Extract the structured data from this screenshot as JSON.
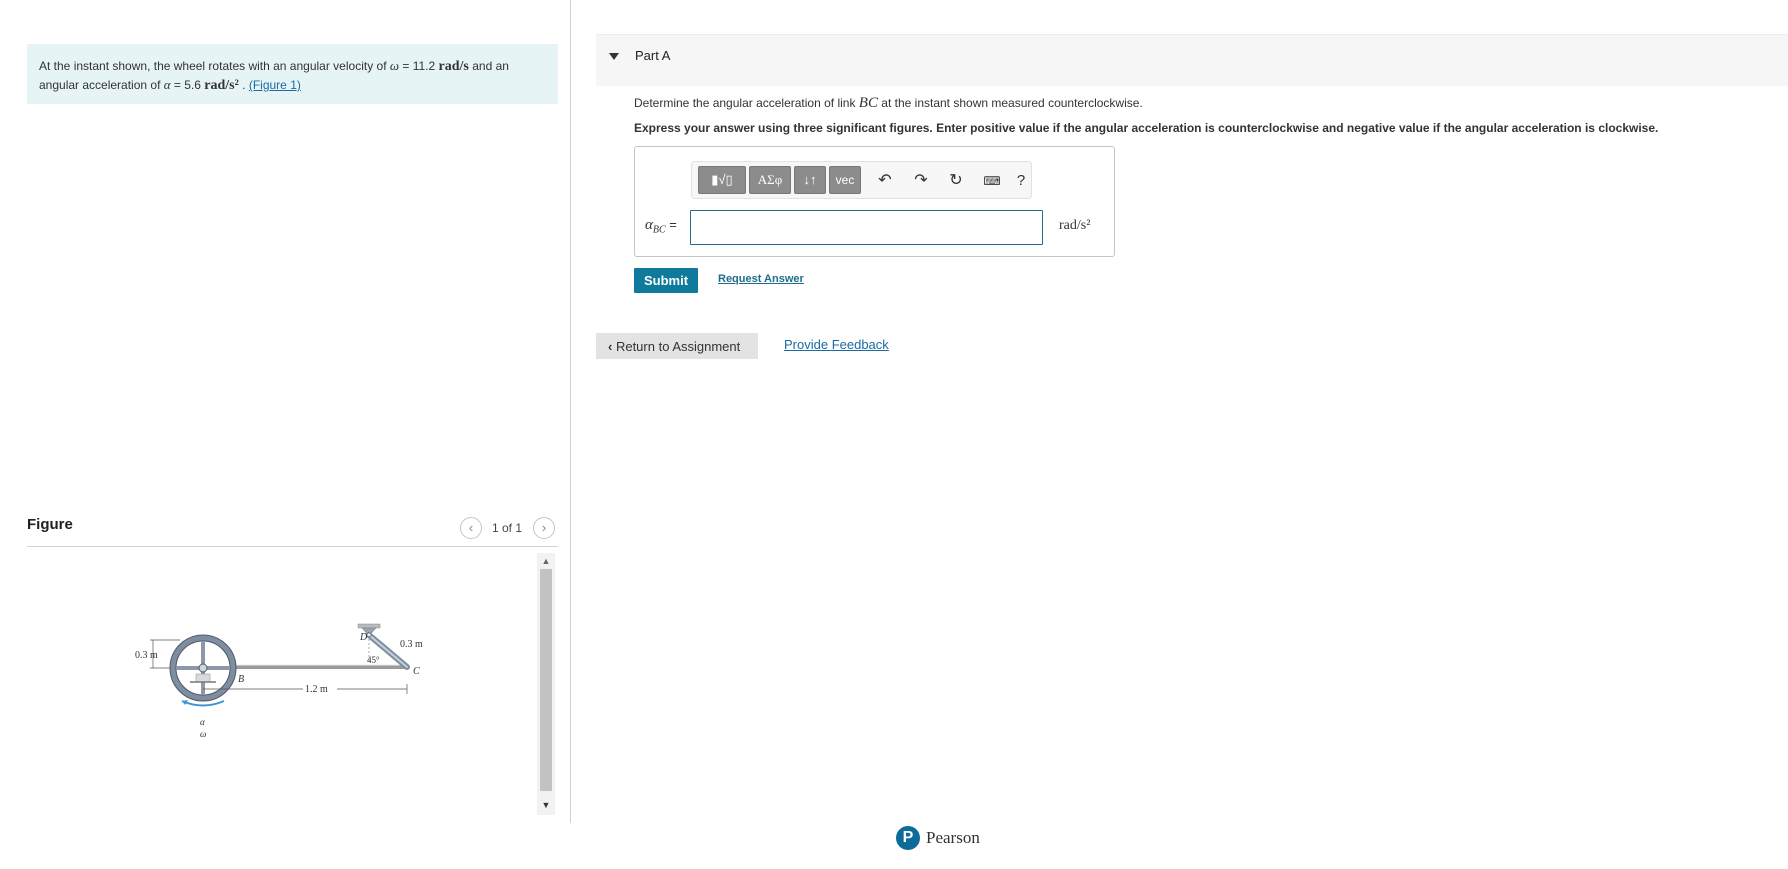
{
  "problem": {
    "prefix": "At the instant shown, the wheel rotates with an angular velocity of",
    "omega_symbol": "ω",
    "omega_value": " = 11.2 ",
    "omega_unit": "rad/s",
    "middle": " and an angular acceleration of ",
    "alpha_symbol": "α",
    "alpha_value": " = 5.6 ",
    "alpha_unit": "rad/s²",
    "figure_link": "(Figure 1)"
  },
  "figure": {
    "title": "Figure",
    "pager": "1 of 1",
    "labels": {
      "wheel_radius": "0.3 m",
      "link_length": "1.2 m",
      "arm_length": "0.3 m",
      "angle": "45°",
      "point_b": "B",
      "point_c": "C",
      "point_d": "D",
      "alpha": "α",
      "omega": "ω"
    }
  },
  "part": {
    "label": "Part A",
    "question_prefix": "Determine the angular acceleration of link ",
    "question_var": "BC",
    "question_suffix": " at the instant shown measured counterclockwise.",
    "instructions": "Express your answer using three significant figures. Enter positive value if the angular acceleration is counterclockwise and negative value if the angular acceleration is clockwise."
  },
  "toolbar": {
    "templates_label": "▮√▯",
    "greek_label": "ΑΣφ",
    "arrows_label": "↓↑",
    "vec_label": "vec",
    "help_label": "?"
  },
  "answer": {
    "var_main": "α",
    "var_sub": "BC",
    "equals": " =",
    "value": "",
    "unit": "rad/s²"
  },
  "actions": {
    "submit": "Submit",
    "request_answer": "Request Answer",
    "return": "Return to Assignment",
    "feedback": "Provide Feedback"
  },
  "footer": {
    "brand": "Pearson"
  }
}
